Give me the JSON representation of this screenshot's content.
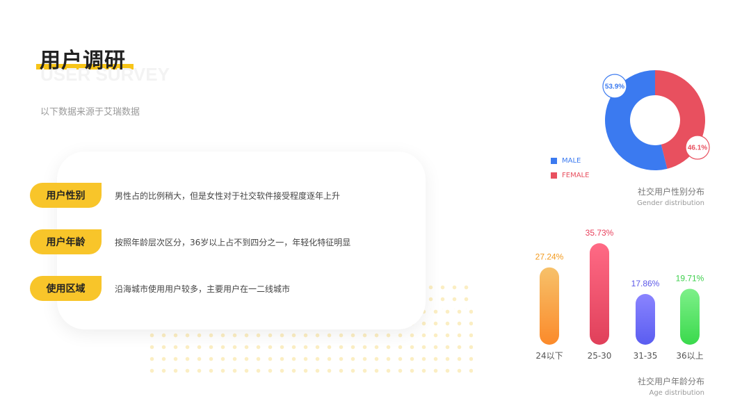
{
  "header": {
    "title": "用户调研",
    "title_en": "USER SURVEY",
    "source": "以下数据来源于艾瑞数据"
  },
  "rows": [
    {
      "label": "用户性别",
      "text": "男性占的比例稍大，但是女性对于社交软件接受程度逐年上升"
    },
    {
      "label": "用户年龄",
      "text": "按照年龄层次区分，36岁以上占不到四分之一，年轻化特征明显"
    },
    {
      "label": "使用区域",
      "text": "沿海城市使用用户较多，主要用户在一二线城市"
    }
  ],
  "gender": {
    "caption_cn": "社交用户性别分布",
    "caption_en": "Gender distribution",
    "legend": [
      {
        "label": "MALE",
        "color": "#3b7af0"
      },
      {
        "label": "FEMALE",
        "color": "#e8505f"
      }
    ]
  },
  "age": {
    "caption_cn": "社交用户年龄分布",
    "caption_en": "Age distribution"
  },
  "chart_data": [
    {
      "type": "pie",
      "categories": [
        "MALE",
        "FEMALE"
      ],
      "values": [
        53.9,
        46.1
      ],
      "value_labels": [
        "53.9%",
        "46.1%"
      ],
      "colors": [
        "#3b7af0",
        "#e8505f"
      ],
      "donut": true
    },
    {
      "type": "bar",
      "categories": [
        "24以下",
        "25-30",
        "31-35",
        "36以上"
      ],
      "values": [
        27.24,
        35.73,
        17.86,
        19.71
      ],
      "value_labels": [
        "27.24%",
        "35.73%",
        "17.86%",
        "19.71%"
      ],
      "colors": [
        [
          "#f7c16a",
          "#fb8a2a"
        ],
        [
          "#ff6a85",
          "#e0405a"
        ],
        [
          "#8a84ff",
          "#5a5df0"
        ],
        [
          "#7ef08a",
          "#3ad94c"
        ]
      ],
      "label_colors": [
        "#f39a1e",
        "#e8405c",
        "#5b57e8",
        "#3ecf4c"
      ]
    }
  ]
}
